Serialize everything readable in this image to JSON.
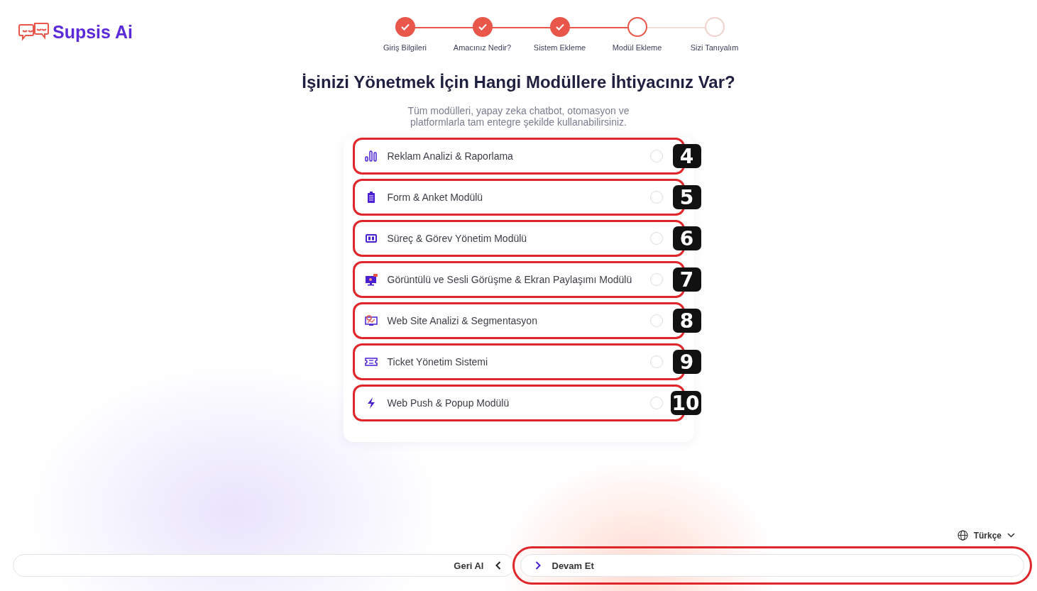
{
  "logo": {
    "text": "Supsis Ai"
  },
  "steps": [
    {
      "label": "Giriş Bilgileri",
      "completed": true,
      "active": false
    },
    {
      "label": "Amacınız Nedir?",
      "completed": true,
      "active": false
    },
    {
      "label": "Sistem Ekleme",
      "completed": true,
      "active": false
    },
    {
      "label": "Modül Ekleme",
      "completed": false,
      "active": true
    },
    {
      "label": "Sizi Tanıyalım",
      "completed": false,
      "active": false
    }
  ],
  "title": "İşinizi Yönetmek İçin Hangi Modüllere İhtiyacınız Var?",
  "subtitle": "Tüm modülleri, yapay zeka chatbot, otomasyon ve platformlarla tam entegre şekilde kullanabilirsiniz.",
  "modules": [
    {
      "kind": "chart",
      "label": "Reklam Analizi & Raporlama",
      "checked": false,
      "highlighted": true,
      "callout": "4"
    },
    {
      "kind": "clipboard",
      "label": "Form & Anket Modülü",
      "checked": false,
      "highlighted": true,
      "callout": "5"
    },
    {
      "kind": "board",
      "label": "Süreç & Görev Yönetim Modülü",
      "checked": false,
      "highlighted": true,
      "callout": "6"
    },
    {
      "kind": "video",
      "label": "Görüntülü ve Sesli Görüşme & Ekran Paylaşımı Modülü",
      "checked": false,
      "highlighted": true,
      "callout": "7"
    },
    {
      "kind": "analytics",
      "label": "Web Site Analizi & Segmentasyon",
      "checked": false,
      "highlighted": true,
      "callout": "8"
    },
    {
      "kind": "ticket",
      "label": "Ticket Yönetim Sistemi",
      "checked": false,
      "highlighted": true,
      "callout": "9"
    },
    {
      "kind": "bolt",
      "label": "Web Push & Popup Modülü",
      "checked": false,
      "highlighted": true,
      "callout": "10"
    }
  ],
  "language": {
    "label": "Türkçe"
  },
  "back_button": {
    "label": "Geri Al",
    "highlighted": false
  },
  "next_button": {
    "label": "Devam Et",
    "highlighted": true
  }
}
